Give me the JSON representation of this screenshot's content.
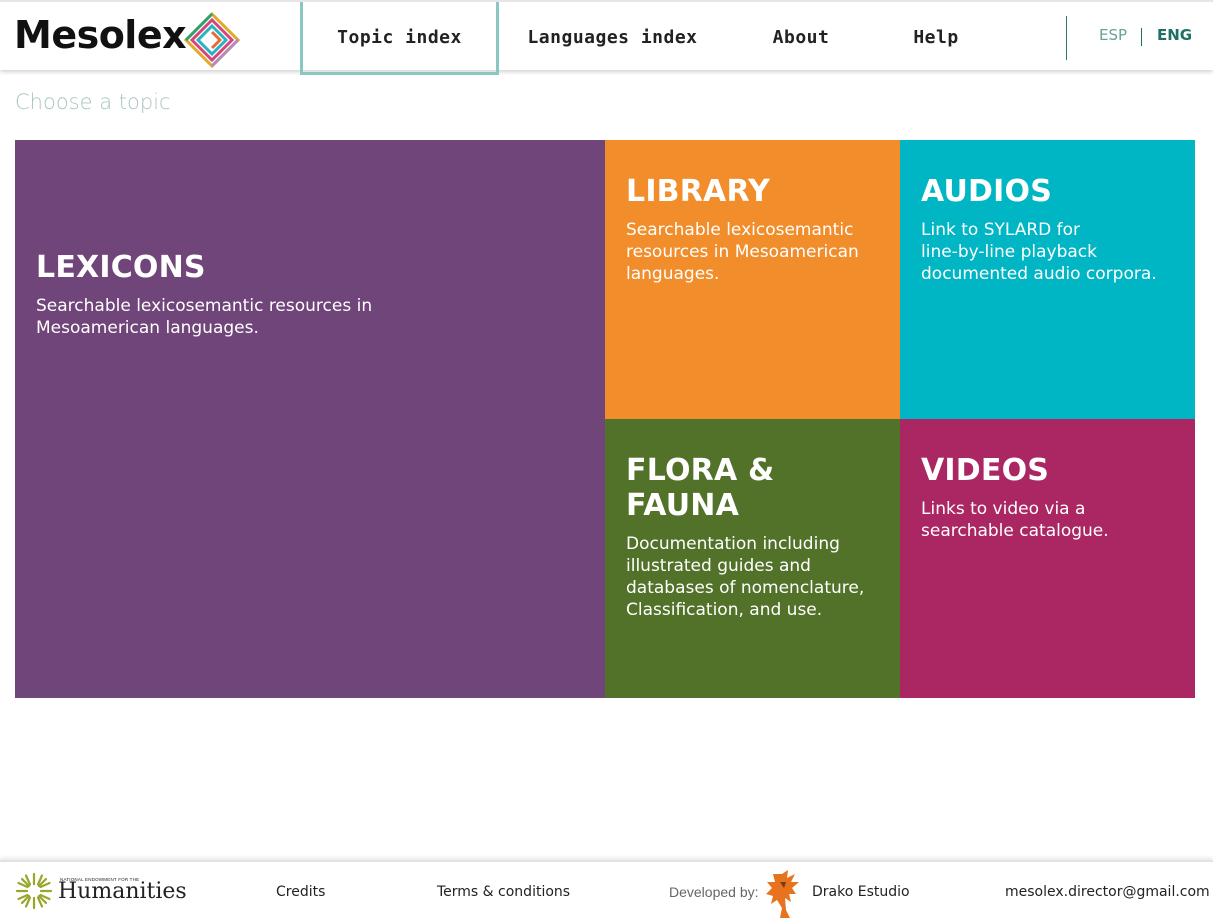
{
  "header": {
    "brand": "Mesolex",
    "nav": [
      {
        "label": "Topic index",
        "active": true
      },
      {
        "label": "Languages index",
        "active": false
      },
      {
        "label": "About",
        "active": false
      },
      {
        "label": "Help",
        "active": false
      }
    ],
    "languages": {
      "esp": "ESP",
      "eng": "ENG",
      "selected": "ENG"
    }
  },
  "main": {
    "prompt": "Choose a topic",
    "tiles": {
      "lexicons": {
        "title": "LEXICONS",
        "line1": "Searchable lexicosemantic resources in",
        "line2": "Mesoamerican languages.",
        "color": "#704579"
      },
      "library": {
        "title": "LIBRARY",
        "line1": "Searchable lexicosemantic",
        "line2": "resources in Mesoamerican",
        "line3": "languages.",
        "color": "#f28d2b"
      },
      "audios": {
        "title": "AUDIOS",
        "line1": "Link to SYLARD for",
        "line2": "line-by-line playback",
        "line3": "documented audio corpora.",
        "color": "#00b6c5"
      },
      "flora": {
        "title": "FLORA & FAUNA",
        "line1": "Documentation including",
        "line2": "illustrated guides and",
        "line3": "databases of nomenclature,",
        "line4": "Classification, and use.",
        "color": "#52722a"
      },
      "videos": {
        "title": "VIDEOS",
        "line1": "Links to video via a",
        "line2": "searchable catalogue.",
        "color": "#ab2763"
      }
    }
  },
  "footer": {
    "neh_small": "NATIONAL ENDOWMENT FOR THE",
    "neh_big": "Humanities",
    "credits": "Credits",
    "terms": "Terms & conditions",
    "developed_by": "Developed by:",
    "developer": "Drako Estudio",
    "email": "mesolex.director@gmail.com"
  }
}
